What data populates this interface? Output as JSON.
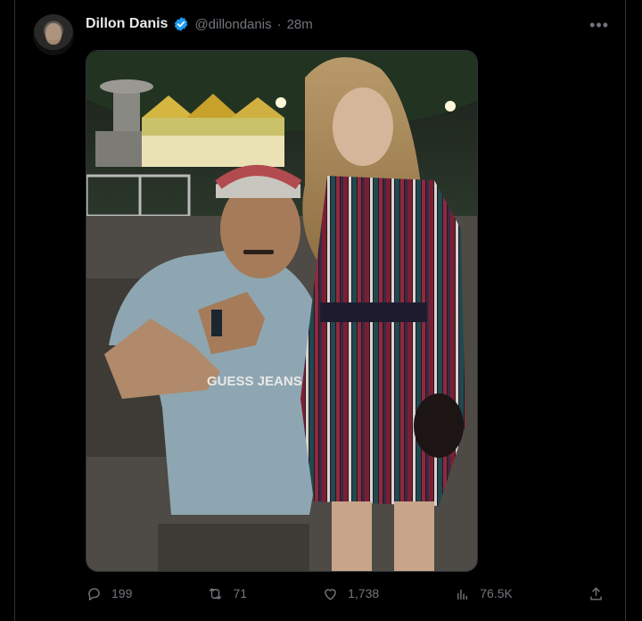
{
  "tweet": {
    "author_name": "Dillon Danis",
    "handle": "@dillondanis",
    "separator": "·",
    "time": "28m",
    "image_alt": "Two people posing together outdoors at night",
    "shirt_text": "GUESS JEANS"
  },
  "actions": {
    "replies": "199",
    "retweets": "71",
    "likes": "1,738",
    "views": "76.5K"
  },
  "colors": {
    "verified": "#1d9bf0",
    "muted": "#71767b",
    "border": "#2f3336"
  }
}
